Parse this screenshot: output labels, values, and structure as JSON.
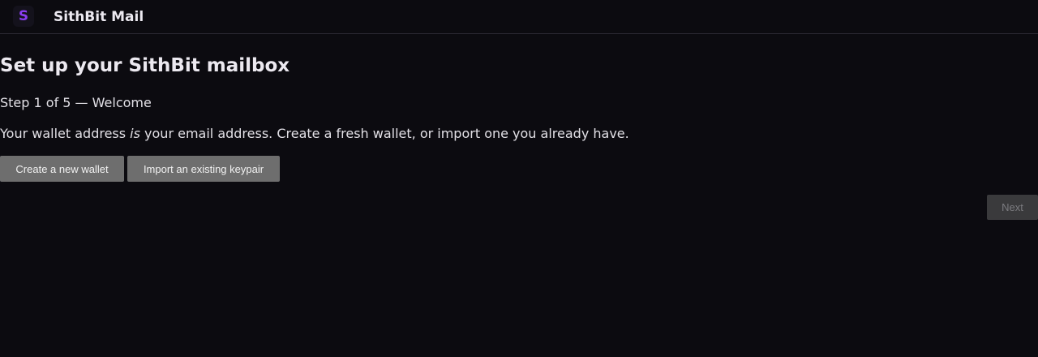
{
  "header": {
    "logo_glyph": "S",
    "title": "SithBit Mail"
  },
  "wizard": {
    "title": "Set up your SithBit mailbox",
    "step_label": "Step 1 of 5 — Welcome",
    "intro_before": "Your wallet address ",
    "intro_emphasis": "is",
    "intro_after": " your email address. Create a fresh wallet, or import one you already have.",
    "create_wallet_label": "Create a new wallet",
    "import_keypair_label": "Import an existing keypair",
    "next_label": "Next",
    "next_enabled": false
  },
  "colors": {
    "background": "#0c0b10",
    "brand_accent": "#8a3df0",
    "button_bg": "#6e6e6e",
    "button_disabled_bg": "#3a3a3c"
  }
}
